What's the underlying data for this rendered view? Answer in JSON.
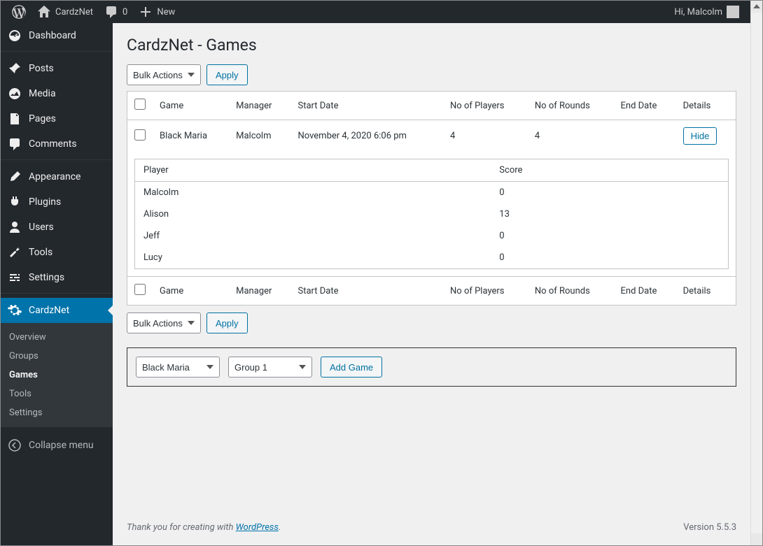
{
  "adminbar": {
    "site_name": "CardzNet",
    "comments_count": "0",
    "new_label": "New",
    "greeting": "Hi, Malcolm"
  },
  "sidebar": {
    "items": [
      {
        "label": "Dashboard"
      },
      {
        "label": "Posts"
      },
      {
        "label": "Media"
      },
      {
        "label": "Pages"
      },
      {
        "label": "Comments"
      },
      {
        "label": "Appearance"
      },
      {
        "label": "Plugins"
      },
      {
        "label": "Users"
      },
      {
        "label": "Tools"
      },
      {
        "label": "Settings"
      },
      {
        "label": "CardzNet"
      }
    ],
    "submenu": [
      {
        "label": "Overview"
      },
      {
        "label": "Groups"
      },
      {
        "label": "Games"
      },
      {
        "label": "Tools"
      },
      {
        "label": "Settings"
      }
    ],
    "collapse_label": "Collapse menu"
  },
  "page": {
    "title": "CardzNet - Games",
    "bulk_actions_label": "Bulk Actions",
    "apply_label": "Apply"
  },
  "table": {
    "headers": {
      "game": "Game",
      "manager": "Manager",
      "start_date": "Start Date",
      "players": "No of Players",
      "rounds": "No of Rounds",
      "end_date": "End Date",
      "details": "Details"
    },
    "row": {
      "game": "Black Maria",
      "manager": "Malcolm",
      "start_date": "November 4, 2020 6:06 pm",
      "players": "4",
      "rounds": "4",
      "end_date": "",
      "details_button": "Hide"
    },
    "inner_headers": {
      "player": "Player",
      "score": "Score"
    },
    "scores": [
      {
        "player": "Malcolm",
        "score": "0"
      },
      {
        "player": "Alison",
        "score": "13"
      },
      {
        "player": "Jeff",
        "score": "0"
      },
      {
        "player": "Lucy",
        "score": "0"
      }
    ]
  },
  "addgame": {
    "game_select": "Black Maria",
    "group_select": "Group 1",
    "button_label": "Add Game"
  },
  "footer": {
    "text_prefix": "Thank you for creating with ",
    "link": "WordPress",
    "text_suffix": ".",
    "version": "Version 5.5.3"
  }
}
